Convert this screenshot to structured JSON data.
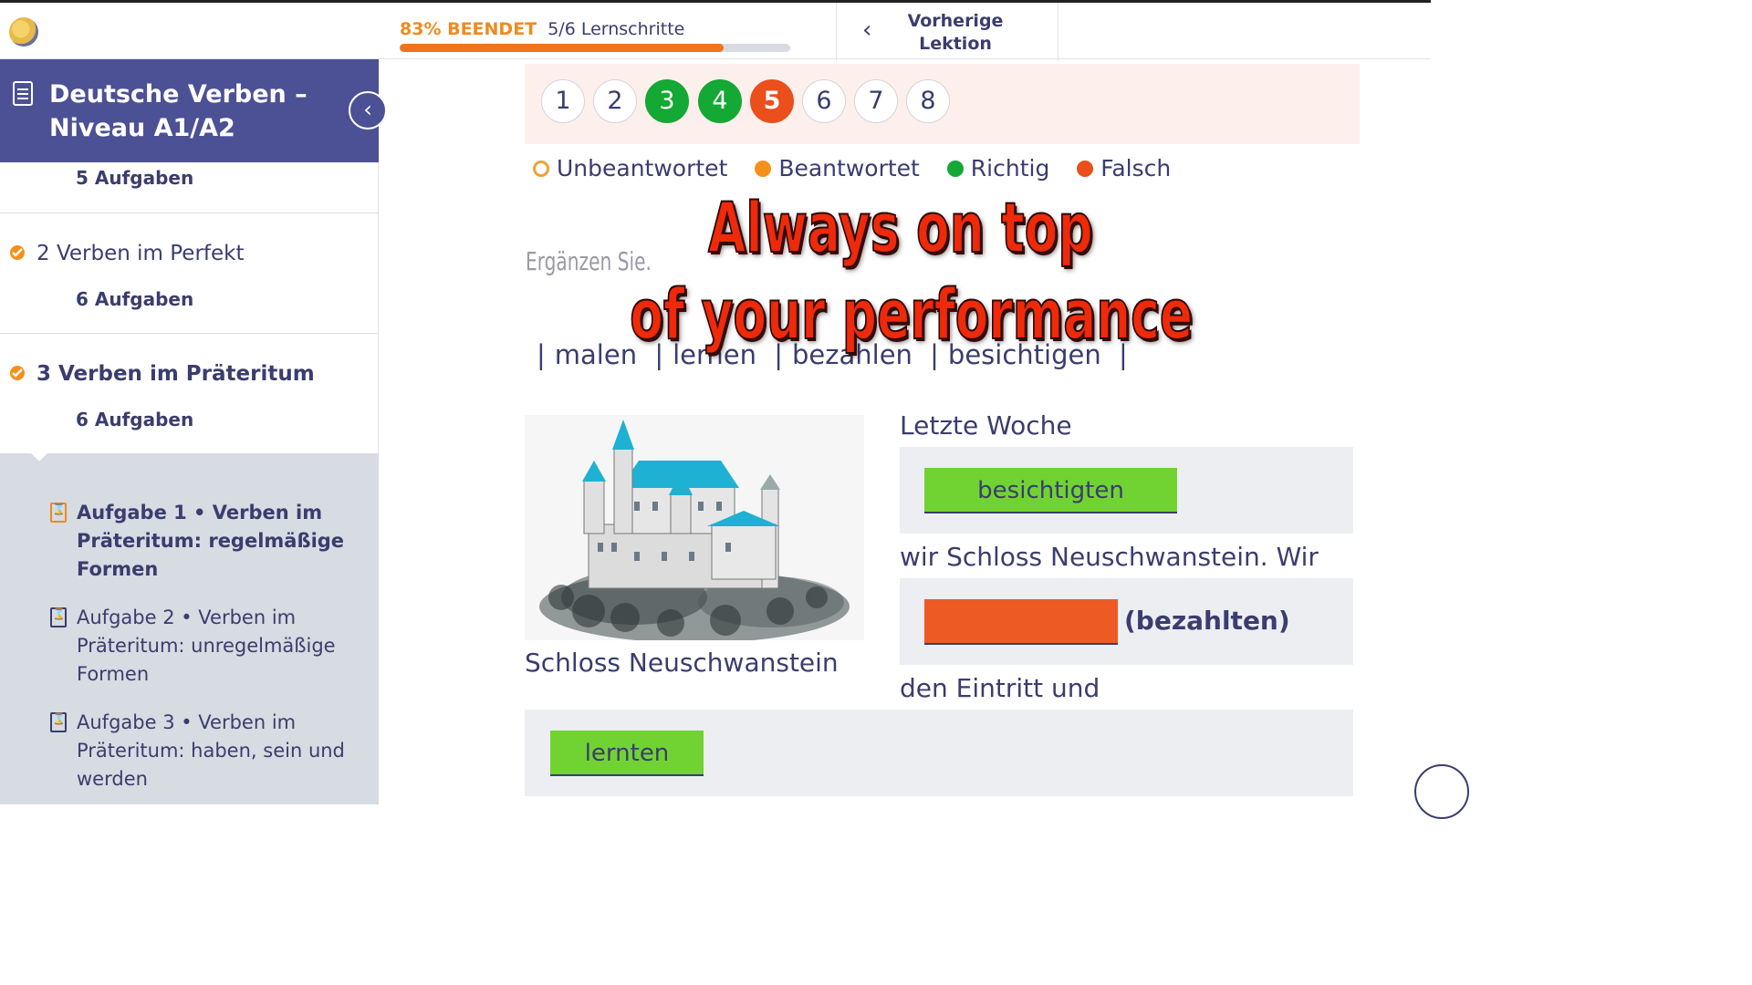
{
  "header": {
    "progress_percent": 83,
    "progress_label": "83% BEENDET",
    "progress_steps": "5/6 Lernschritte",
    "prev_lesson_label": "Vorherige Lektion"
  },
  "sidebar": {
    "course_title": "Deutsche Verben – Niveau A1/A2",
    "first_count": "5 Aufgaben",
    "chapters": [
      {
        "label": "2 Verben im Perfekt",
        "count": "6 Aufgaben",
        "done": true
      },
      {
        "label": "3 Verben im Präteritum",
        "count": "6 Aufgaben",
        "done": true,
        "active": true
      }
    ],
    "tasks": [
      {
        "label": "Aufgabe 1 • Verben im Präteritum: regelmäßige Formen",
        "active": true
      },
      {
        "label": "Aufgabe 2 • Verben im Präteritum: unregelmäßige Formen",
        "active": false
      },
      {
        "label": "Aufgabe 3 • Verben im Präteritum: haben, sein und werden",
        "active": false
      }
    ]
  },
  "quiz": {
    "numbers": [
      {
        "label": "1",
        "state": "unanswered"
      },
      {
        "label": "2",
        "state": "unanswered"
      },
      {
        "label": "3",
        "state": "correct"
      },
      {
        "label": "4",
        "state": "correct"
      },
      {
        "label": "5",
        "state": "wrong"
      },
      {
        "label": "6",
        "state": "unanswered"
      },
      {
        "label": "7",
        "state": "unanswered"
      },
      {
        "label": "8",
        "state": "unanswered"
      }
    ],
    "legend": {
      "unanswered": "Unbeantwortet",
      "answered": "Beantwortet",
      "correct": "Richtig",
      "wrong": "Falsch"
    },
    "instruction": "Ergänzen Sie.",
    "wordbank": [
      "malen",
      "lernen",
      "bezahlen",
      "besichtigen"
    ],
    "image_caption": "Schloss Neuschwanstein",
    "line1": "Letzte Woche",
    "answer1": "besichtigten",
    "line2": "wir Schloss Neuschwanstein. Wir",
    "answer2": "",
    "hint2": "(bezahlten)",
    "line3": "den Eintritt und",
    "answer3": "lernten"
  },
  "overlay": {
    "line1": "Always on top",
    "line2": "of your performance"
  },
  "colors": {
    "primary": "#4c5196",
    "progress": "#f0741c",
    "correct": "#14a834",
    "wrong": "#ea4f1c",
    "answer_green": "#71d332"
  }
}
